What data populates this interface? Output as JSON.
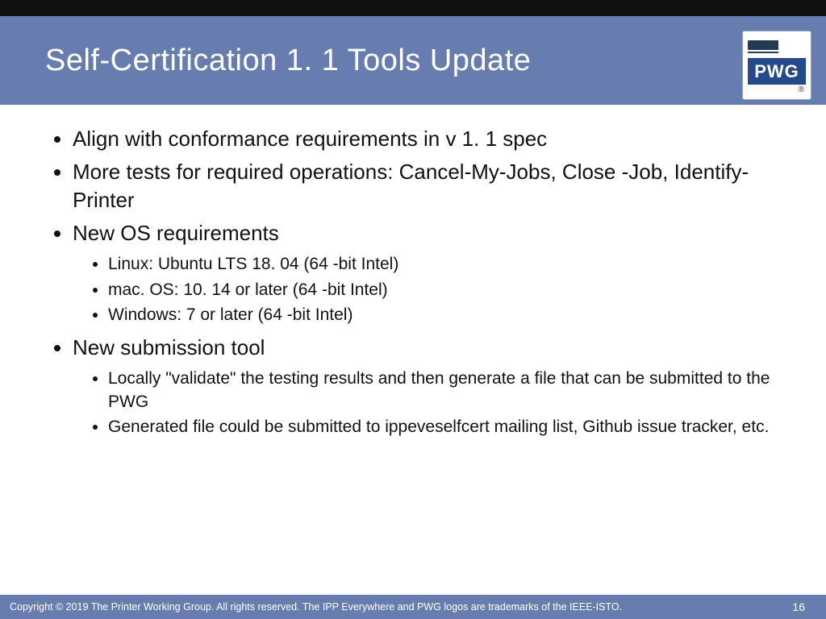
{
  "header": {
    "title": "Self-Certification 1. 1 Tools Update",
    "logo_text": "PWG",
    "registered": "®"
  },
  "bullets": {
    "b1": "Align with conformance requirements in v 1. 1 spec",
    "b2": "More tests for required operations: Cancel-My-Jobs, Close -Job, Identify-Printer",
    "b3": "New OS requirements",
    "b3_sub": {
      "s1": "Linux: Ubuntu LTS 18. 04 (64 -bit Intel)",
      "s2": "mac. OS: 10. 14 or later (64 -bit Intel)",
      "s3": "Windows: 7 or later (64 -bit Intel)"
    },
    "b4": "New submission tool",
    "b4_sub": {
      "s1": "Locally \"validate\" the testing results and then generate a file that can be submitted to the PWG",
      "s2": "Generated file could be submitted to ippeveselfcert mailing list, Github issue tracker, etc."
    }
  },
  "footer": {
    "copyright": "Copyright © 2019 The Printer Working Group. All rights reserved. The IPP Everywhere and PWG logos are trademarks of the IEEE-ISTO.",
    "page": "16"
  }
}
